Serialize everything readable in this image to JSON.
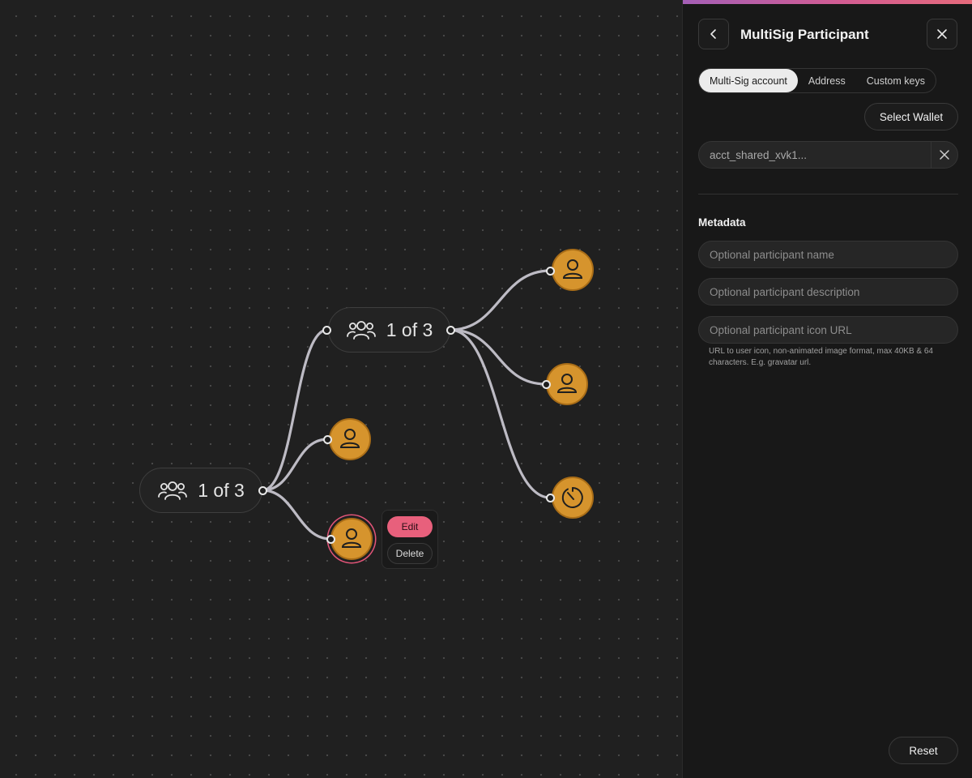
{
  "canvas": {
    "group_nodes": [
      {
        "label": "1 of 3"
      },
      {
        "label": "1 of 3"
      }
    ],
    "context_menu": {
      "edit_label": "Edit",
      "delete_label": "Delete"
    }
  },
  "panel": {
    "title": "MultiSig Participant",
    "tabs": [
      {
        "label": "Multi-Sig account",
        "active": true
      },
      {
        "label": "Address",
        "active": false
      },
      {
        "label": "Custom keys",
        "active": false
      }
    ],
    "select_wallet_label": "Select Wallet",
    "account_value": "acct_shared_xvk1...",
    "metadata": {
      "title": "Metadata",
      "name_placeholder": "Optional participant name",
      "description_placeholder": "Optional participant description",
      "icon_url_placeholder": "Optional participant icon URL",
      "icon_url_hint": "URL to user icon, non-animated image format, max 40KB & 64 characters. E.g. gravatar url."
    },
    "reset_label": "Reset"
  },
  "colors": {
    "accent_gradient": [
      "#a45fb6",
      "#d35c92",
      "#e66a7b"
    ],
    "participant_orange": "#d6942d",
    "edit_pink": "#e8607c"
  }
}
